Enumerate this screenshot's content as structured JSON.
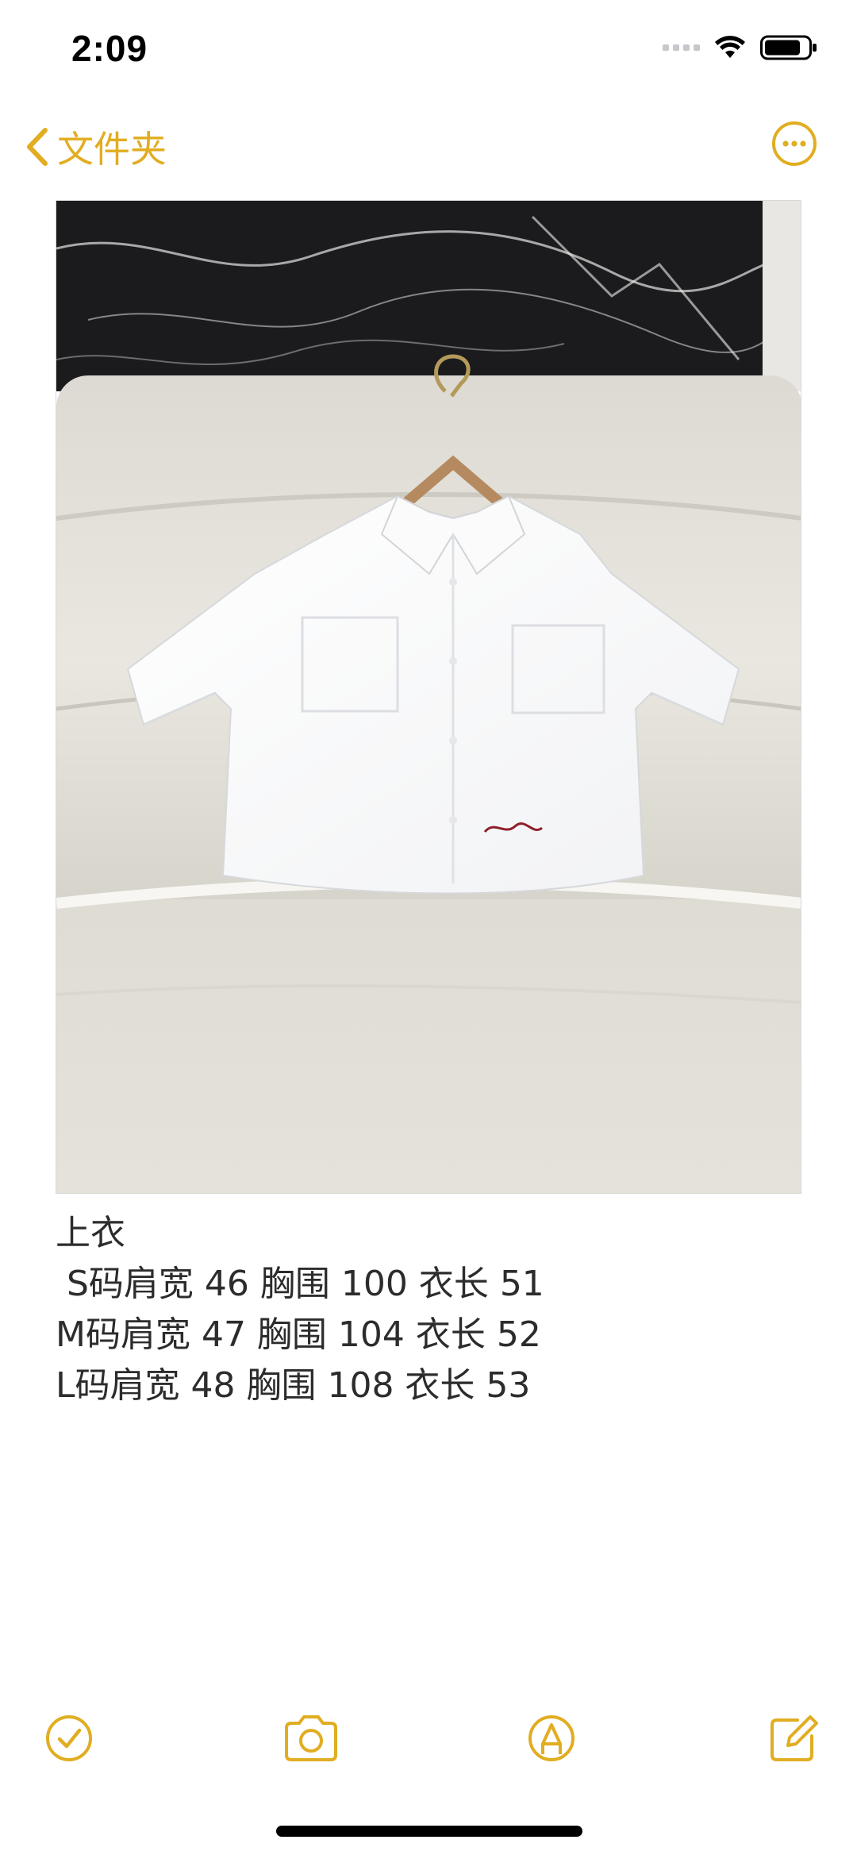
{
  "status_bar": {
    "time": "2:09"
  },
  "nav": {
    "back_label": "文件夹",
    "accent_color": "#e1ad21"
  },
  "note": {
    "photo_icon": "shirt-photo",
    "lines": [
      "上衣",
      " S码肩宽 46 胸围 100 衣长 51",
      "M码肩宽 47 胸围 104 衣长 52",
      "L码肩宽 48 胸围 108 衣长 53"
    ]
  },
  "toolbar": {
    "icons": [
      "checklist-icon",
      "camera-icon",
      "markup-icon",
      "compose-icon"
    ]
  }
}
